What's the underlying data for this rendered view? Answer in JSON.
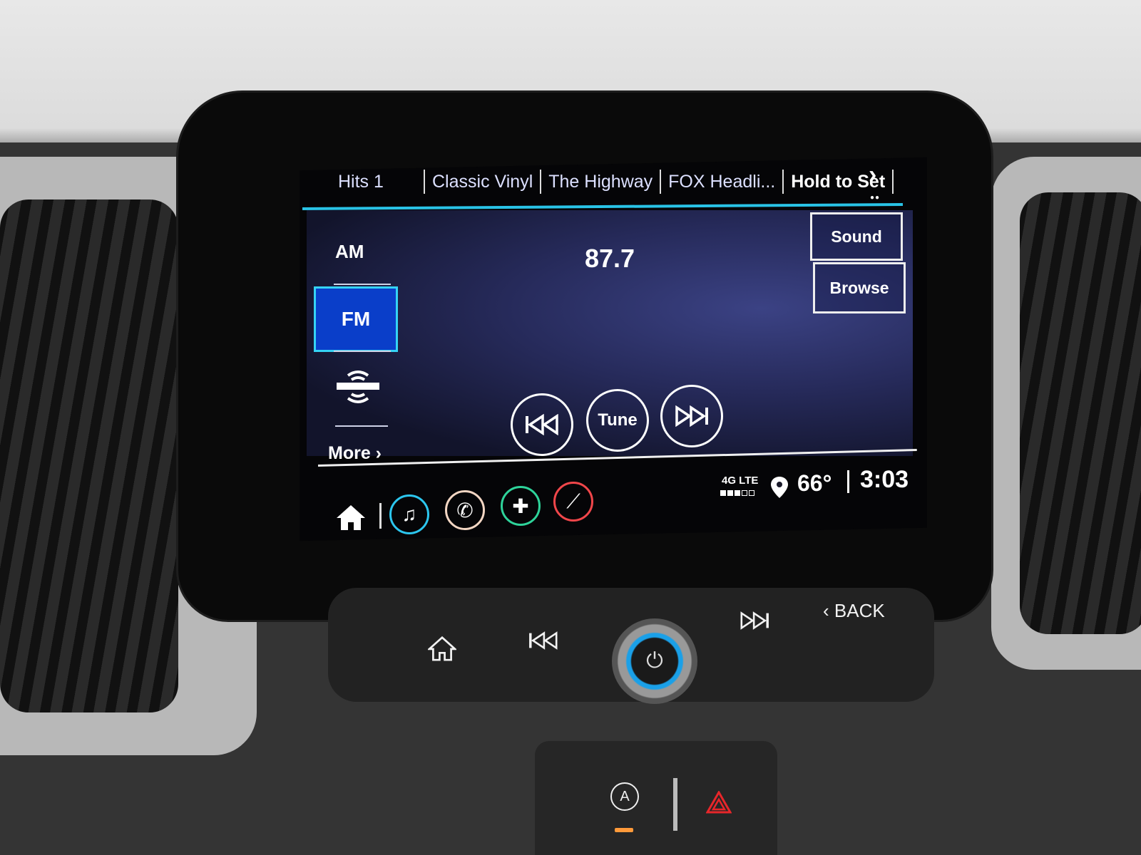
{
  "presets": {
    "items": [
      {
        "label": "Hits 1",
        "bold": false
      },
      {
        "label": "Classic Vinyl",
        "bold": false
      },
      {
        "label": "The Highway",
        "bold": false
      },
      {
        "label": "FOX Headli...",
        "bold": false
      },
      {
        "label": "Hold to Set",
        "bold": true
      }
    ],
    "next_icon": "chevron-right-icon",
    "page_indicator": "●●"
  },
  "sources": {
    "am": "AM",
    "fm": "FM",
    "siriusxm_icon": "satellite-radio-icon",
    "more": "More ›",
    "selected": "FM"
  },
  "tuner": {
    "frequency": "87.7",
    "seek_back_icon": "seek-back-icon",
    "tune_label": "Tune",
    "seek_forward_icon": "seek-forward-icon"
  },
  "actions": {
    "sound": "Sound",
    "browse": "Browse"
  },
  "status_bar": {
    "network": "4G LTE",
    "signal_bars": 3,
    "signal_bars_max": 5,
    "location_icon": "location-pin-icon",
    "temperature": "66°",
    "time": "3:03"
  },
  "app_tray": {
    "home_icon": "home-icon",
    "apps": [
      {
        "name": "audio",
        "icon": "music-note-icon",
        "glyph": "♫",
        "color": "#2cc6ee",
        "active": true
      },
      {
        "name": "phone",
        "icon": "phone-icon",
        "glyph": "✆",
        "color": "#f3d6c3",
        "active": false
      },
      {
        "name": "navigation",
        "icon": "nav-cross-icon",
        "glyph": "✚",
        "color": "#2ed39a",
        "active": false
      },
      {
        "name": "climate",
        "icon": "seat-icon",
        "glyph": "⟋",
        "color": "#f0464a",
        "active": false
      }
    ]
  },
  "hardware": {
    "home_icon": "home-icon",
    "prev_icon": "seek-back-icon",
    "power_icon": "power-icon",
    "next_icon": "seek-forward-icon",
    "back_label": "‹ BACK",
    "auto_stop_icon": "auto-stop-icon",
    "hazard_icon": "hazard-icon"
  },
  "colors": {
    "accent": "#29c3e6",
    "selected_band": "#0a3ec9",
    "hazard": "#e8262a"
  }
}
